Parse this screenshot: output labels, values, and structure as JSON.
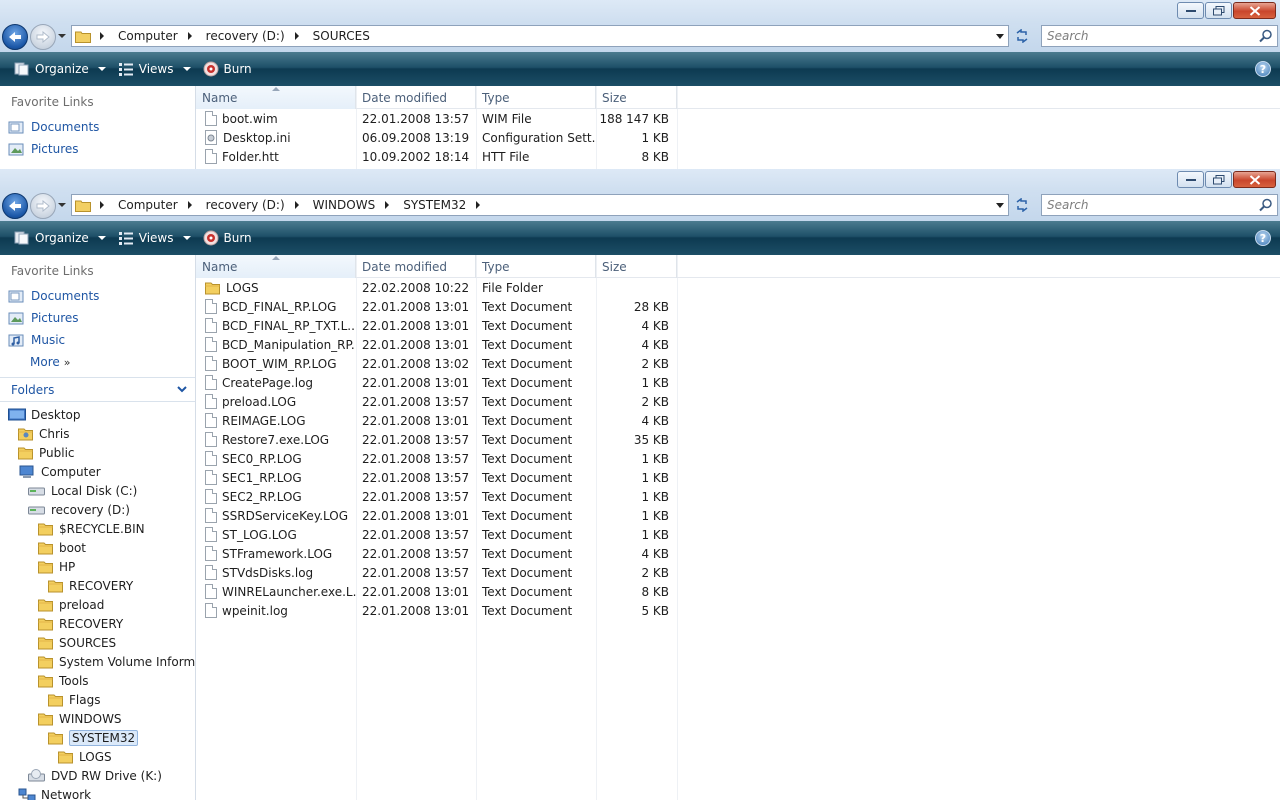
{
  "windows": {
    "top": {
      "breadcrumb": [
        "Computer",
        "recovery (D:)",
        "SOURCES"
      ],
      "search_placeholder": "Search",
      "toolbar": {
        "organize": "Organize",
        "views": "Views",
        "burn": "Burn"
      },
      "favorite_links_header": "Favorite Links",
      "favorites": [
        "Documents",
        "Pictures"
      ],
      "columns": {
        "name": "Name",
        "date": "Date modified",
        "type": "Type",
        "size": "Size"
      },
      "files": [
        {
          "name": "boot.wim",
          "date": "22.01.2008 13:57",
          "type": "WIM File",
          "size": "188 147 KB",
          "icon": "file-icon"
        },
        {
          "name": "Desktop.ini",
          "date": "06.09.2008 13:19",
          "type": "Configuration Sett...",
          "size": "1 KB",
          "icon": "settings-file-icon"
        },
        {
          "name": "Folder.htt",
          "date": "10.09.2002 18:14",
          "type": "HTT File",
          "size": "8 KB",
          "icon": "file-icon"
        }
      ]
    },
    "bottom": {
      "breadcrumb": [
        "Computer",
        "recovery (D:)",
        "WINDOWS",
        "SYSTEM32"
      ],
      "search_placeholder": "Search",
      "toolbar": {
        "organize": "Organize",
        "views": "Views",
        "burn": "Burn"
      },
      "favorite_links_header": "Favorite Links",
      "favorites": [
        "Documents",
        "Pictures",
        "Music"
      ],
      "more_label": "More",
      "folders_header": "Folders",
      "tree": [
        {
          "label": "Desktop",
          "icon": "desktop-icon"
        },
        {
          "label": "Chris",
          "icon": "user-folder-icon"
        },
        {
          "label": "Public",
          "icon": "folder-icon"
        },
        {
          "label": "Computer",
          "icon": "computer-icon"
        },
        {
          "label": "Local Disk (C:)",
          "icon": "drive-icon"
        },
        {
          "label": "recovery (D:)",
          "icon": "drive-icon"
        },
        {
          "label": "$RECYCLE.BIN",
          "icon": "folder-icon"
        },
        {
          "label": "boot",
          "icon": "folder-icon"
        },
        {
          "label": "HP",
          "icon": "folder-icon"
        },
        {
          "label": "RECOVERY",
          "icon": "folder-icon"
        },
        {
          "label": "preload",
          "icon": "folder-icon"
        },
        {
          "label": "RECOVERY",
          "icon": "folder-icon"
        },
        {
          "label": "SOURCES",
          "icon": "folder-icon"
        },
        {
          "label": "System Volume Informat",
          "icon": "folder-icon"
        },
        {
          "label": "Tools",
          "icon": "folder-icon"
        },
        {
          "label": "Flags",
          "icon": "folder-icon"
        },
        {
          "label": "WINDOWS",
          "icon": "folder-icon"
        },
        {
          "label": "SYSTEM32",
          "icon": "folder-icon",
          "selected": true
        },
        {
          "label": "LOGS",
          "icon": "folder-icon"
        },
        {
          "label": "DVD RW Drive (K:)",
          "icon": "dvd-drive-icon"
        },
        {
          "label": "Network",
          "icon": "network-icon"
        }
      ],
      "columns": {
        "name": "Name",
        "date": "Date modified",
        "type": "Type",
        "size": "Size"
      },
      "files": [
        {
          "name": "LOGS",
          "date": "22.02.2008 10:22",
          "type": "File Folder",
          "size": "",
          "icon": "folder-icon"
        },
        {
          "name": "BCD_FINAL_RP.LOG",
          "date": "22.01.2008 13:01",
          "type": "Text Document",
          "size": "28 KB",
          "icon": "text-document-icon"
        },
        {
          "name": "BCD_FINAL_RP_TXT.L...",
          "date": "22.01.2008 13:01",
          "type": "Text Document",
          "size": "4 KB",
          "icon": "text-document-icon"
        },
        {
          "name": "BCD_Manipulation_RP....",
          "date": "22.01.2008 13:01",
          "type": "Text Document",
          "size": "4 KB",
          "icon": "text-document-icon"
        },
        {
          "name": "BOOT_WIM_RP.LOG",
          "date": "22.01.2008 13:02",
          "type": "Text Document",
          "size": "2 KB",
          "icon": "text-document-icon"
        },
        {
          "name": "CreatePage.log",
          "date": "22.01.2008 13:01",
          "type": "Text Document",
          "size": "1 KB",
          "icon": "text-document-icon"
        },
        {
          "name": "preload.LOG",
          "date": "22.01.2008 13:57",
          "type": "Text Document",
          "size": "2 KB",
          "icon": "text-document-icon"
        },
        {
          "name": "REIMAGE.LOG",
          "date": "22.01.2008 13:01",
          "type": "Text Document",
          "size": "4 KB",
          "icon": "text-document-icon"
        },
        {
          "name": "Restore7.exe.LOG",
          "date": "22.01.2008 13:57",
          "type": "Text Document",
          "size": "35 KB",
          "icon": "text-document-icon"
        },
        {
          "name": "SEC0_RP.LOG",
          "date": "22.01.2008 13:57",
          "type": "Text Document",
          "size": "1 KB",
          "icon": "text-document-icon"
        },
        {
          "name": "SEC1_RP.LOG",
          "date": "22.01.2008 13:57",
          "type": "Text Document",
          "size": "1 KB",
          "icon": "text-document-icon"
        },
        {
          "name": "SEC2_RP.LOG",
          "date": "22.01.2008 13:57",
          "type": "Text Document",
          "size": "1 KB",
          "icon": "text-document-icon"
        },
        {
          "name": "SSRDServiceKey.LOG",
          "date": "22.01.2008 13:01",
          "type": "Text Document",
          "size": "1 KB",
          "icon": "text-document-icon"
        },
        {
          "name": "ST_LOG.LOG",
          "date": "22.01.2008 13:57",
          "type": "Text Document",
          "size": "1 KB",
          "icon": "text-document-icon"
        },
        {
          "name": "STFramework.LOG",
          "date": "22.01.2008 13:57",
          "type": "Text Document",
          "size": "4 KB",
          "icon": "text-document-icon"
        },
        {
          "name": "STVdsDisks.log",
          "date": "22.01.2008 13:57",
          "type": "Text Document",
          "size": "2 KB",
          "icon": "text-document-icon"
        },
        {
          "name": "WINRELauncher.exe.L...",
          "date": "22.01.2008 13:01",
          "type": "Text Document",
          "size": "8 KB",
          "icon": "text-document-icon"
        },
        {
          "name": "wpeinit.log",
          "date": "22.01.2008 13:01",
          "type": "Text Document",
          "size": "5 KB",
          "icon": "text-document-icon"
        }
      ]
    }
  },
  "colors": {
    "link": "#1f56a4",
    "toolbar": "#1e5068",
    "selection": "#dbe9f9",
    "chrome": "#cfdff0"
  }
}
